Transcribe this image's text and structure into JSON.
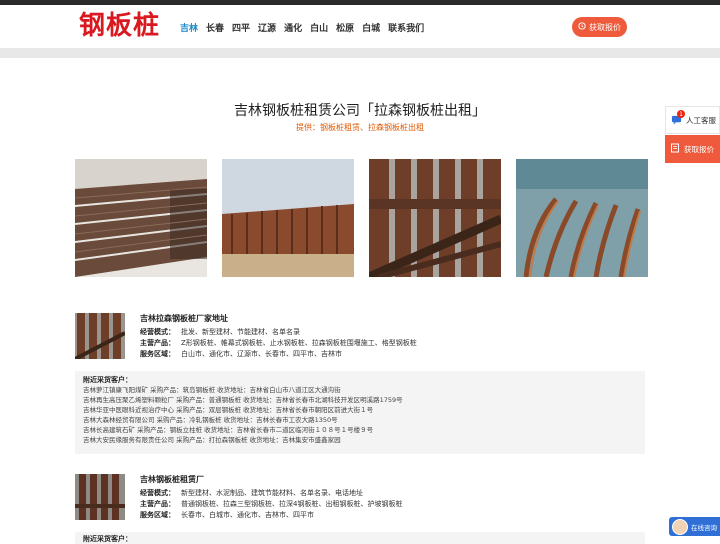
{
  "header": {
    "logo": "钢板桩",
    "nav": [
      "吉林",
      "长春",
      "四平",
      "辽源",
      "通化",
      "白山",
      "松原",
      "白城",
      "联系我们"
    ],
    "quote_button": "获取报价"
  },
  "main": {
    "title": "吉林钢板桩租赁公司「拉森钢板桩出租」",
    "subtitle": "提供：钢板桩租赁、拉森钢板桩出租"
  },
  "companies": [
    {
      "name": "吉林拉森钢板桩厂家地址",
      "mode_label": "经营模式：",
      "mode": "批发、新型建材、节能建材、名单名录",
      "products_label": "主营产品：",
      "products": "Z形钢板桩、帷幕式钢板桩、止水钢板桩、拉森钢板桩围堰施工、格型钢板桩",
      "area_label": "服务区域：",
      "area": "白山市、通化市、辽源市、长春市、四平市、吉林市",
      "buyers_title": "附近采货客户：",
      "buyers": [
        "吉林萝江镇康飞阳煤矿   采购产品：筑岛钢板桩   收货地址：吉林省白山市八道江区大通沟街",
        "吉林再生高压聚乙烯塑料颗粒厂   采购产品：普通钢板桩   收货地址：吉林省长春市北湖科技开发区明溪路1759号",
        "吉林华亚中医眼科近视治疗中心   采购产品：双层钢板桩   收货地址：吉林省长春市朝阳区前进大街１号",
        "吉林大森林经贸有限公司   采购产品：冷轧钢板桩   收货地址：吉林长春市工农大路1350号",
        "吉林长高建筑石矿   采购产品：钢板立柱桩   收货地址：吉林省长春市二道区临河街１０８号１号楼９号",
        "吉林大安民缘服务有限责任公司   采购产品：打拉森钢板桩   收货地址：吉林集安市盛鑫家园"
      ]
    },
    {
      "name": "吉林钢板桩租赁厂",
      "mode_label": "经营模式：",
      "mode": "新型建材、水泥制品、建筑节能材料、名单名录、电话地址",
      "products_label": "主营产品：",
      "products": "普通钢板桩、拉森三型钢板桩、拉深4钢板桩、出租钢板桩、护坡钢板桩",
      "area_label": "服务区域：",
      "area": "长春市、白城市、通化市、吉林市、四平市",
      "buyers_title": "附近采货客户："
    }
  ],
  "side": {
    "service_label": "人工客服",
    "service_badge": "1",
    "quote_label": "获取报价",
    "chat_label": "在线咨询"
  },
  "colors": {
    "logo_red": "#d9181f",
    "nav_active": "#1e88c8",
    "accent_orange": "#ee5a3b",
    "subtitle_orange": "#e05a00"
  }
}
